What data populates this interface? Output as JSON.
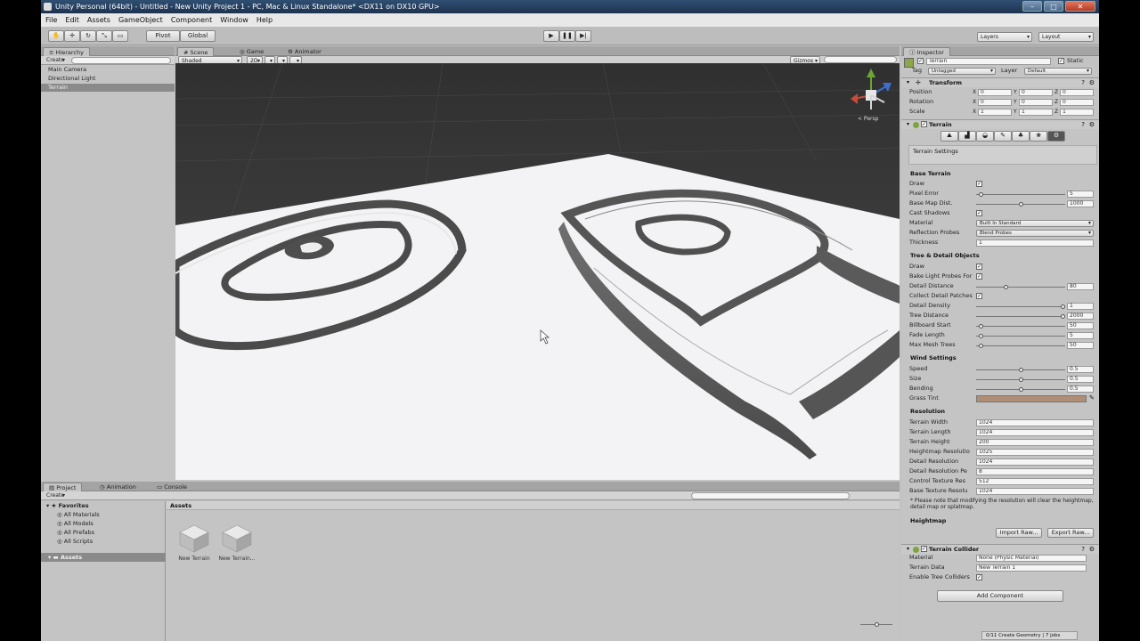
{
  "window": {
    "title": "Unity Personal (64bit) - Untitled - New Unity Project 1 - PC, Mac & Linux Standalone* <DX11 on DX10 GPU>"
  },
  "menu": [
    "File",
    "Edit",
    "Assets",
    "GameObject",
    "Component",
    "Window",
    "Help"
  ],
  "toolbar": {
    "pivot": "Pivot",
    "global": "Global",
    "layers": "Layers",
    "layout": "Layout"
  },
  "hierarchy": {
    "tab": "Hierarchy",
    "create": "Create",
    "items": [
      "Main Camera",
      "Directional Light",
      "Terrain"
    ],
    "selected": "Terrain"
  },
  "scene": {
    "tab_scene": "Scene",
    "tab_game": "Game",
    "tab_animator": "Animator",
    "shading": "Shaded",
    "mode_2d": "2D",
    "gizmos": "Gizmos",
    "persp": "< Persp"
  },
  "project": {
    "tabs": [
      "Project",
      "Animation",
      "Console"
    ],
    "create": "Create",
    "favorites_label": "Favorites",
    "favorites": [
      "All Materials",
      "All Models",
      "All Prefabs",
      "All Scripts"
    ],
    "assets_label": "Assets",
    "breadcrumb": "Assets",
    "assets": [
      "New Terrain",
      "New Terrain..."
    ]
  },
  "inspector": {
    "tab": "Inspector",
    "object_name": "Terrain",
    "static": "Static",
    "tag_label": "Tag",
    "tag_value": "Untagged",
    "layer_label": "Layer",
    "layer_value": "Default",
    "transform": {
      "title": "Transform",
      "rows": [
        {
          "label": "Position",
          "x": "0",
          "y": "0",
          "z": "0"
        },
        {
          "label": "Rotation",
          "x": "0",
          "y": "0",
          "z": "0"
        },
        {
          "label": "Scale",
          "x": "1",
          "y": "1",
          "z": "1"
        }
      ]
    },
    "terrain": {
      "title": "Terrain",
      "settings_box": "Terrain Settings",
      "base_title": "Base Terrain",
      "base": [
        {
          "label": "Draw",
          "type": "check"
        },
        {
          "label": "Pixel Error",
          "type": "slider",
          "value": "5",
          "fraction": 0.03
        },
        {
          "label": "Base Map Dist.",
          "type": "slider",
          "value": "1000",
          "fraction": 0.5
        },
        {
          "label": "Cast Shadows",
          "type": "check"
        },
        {
          "label": "Material",
          "type": "dropdown",
          "value": "Built In Standard"
        },
        {
          "label": "Reflection Probes",
          "type": "dropdown",
          "value": "Blend Probes"
        },
        {
          "label": "Thickness",
          "type": "field",
          "value": "1"
        }
      ],
      "tree_title": "Tree & Detail Objects",
      "tree": [
        {
          "label": "Draw",
          "type": "check"
        },
        {
          "label": "Bake Light Probes For",
          "type": "check"
        },
        {
          "label": "Detail Distance",
          "type": "slider",
          "value": "80",
          "fraction": 0.33
        },
        {
          "label": "Collect Detail Patches",
          "type": "check"
        },
        {
          "label": "Detail Density",
          "type": "slider",
          "value": "1",
          "fraction": 1.0
        },
        {
          "label": "Tree Distance",
          "type": "slider",
          "value": "2000",
          "fraction": 1.0
        },
        {
          "label": "Billboard Start",
          "type": "slider",
          "value": "50",
          "fraction": 0.03
        },
        {
          "label": "Fade Length",
          "type": "slider",
          "value": "5",
          "fraction": 0.03
        },
        {
          "label": "Max Mesh Trees",
          "type": "slider",
          "value": "50",
          "fraction": 0.03
        }
      ],
      "wind_title": "Wind Settings",
      "wind": [
        {
          "label": "Speed",
          "type": "slider",
          "value": "0.5",
          "fraction": 0.5
        },
        {
          "label": "Size",
          "type": "slider",
          "value": "0.5",
          "fraction": 0.5
        },
        {
          "label": "Bending",
          "type": "slider",
          "value": "0.5",
          "fraction": 0.5
        },
        {
          "label": "Grass Tint",
          "type": "color",
          "color": "#b08e76"
        }
      ],
      "res_title": "Resolution",
      "resolution": [
        {
          "label": "Terrain Width",
          "value": "1024"
        },
        {
          "label": "Terrain Length",
          "value": "1024"
        },
        {
          "label": "Terrain Height",
          "value": "200"
        },
        {
          "label": "Heightmap Resolutio",
          "value": "1025"
        },
        {
          "label": "Detail Resolution",
          "value": "1024"
        },
        {
          "label": "Detail Resolution Pe",
          "value": "8"
        },
        {
          "label": "Control Texture Res",
          "value": "512"
        },
        {
          "label": "Base Texture Resolu",
          "value": "1024"
        }
      ],
      "note": "* Please note that modifying the resolution will clear the heightmap, detail map or splatmap.",
      "heightmap_title": "Heightmap",
      "import_raw": "Import Raw...",
      "export_raw": "Export Raw..."
    },
    "collider": {
      "title": "Terrain Collider",
      "rows": [
        {
          "label": "Material",
          "value": "None (Physic Material)"
        },
        {
          "label": "Terrain Data",
          "value": "New Terrain 1"
        },
        {
          "label": "Enable Tree Colliders",
          "value": ""
        }
      ]
    },
    "add_component": "Add Component"
  },
  "status": {
    "text": "0/11 Create Geometry | 7 jobs"
  },
  "colors": {
    "sky": "#3b3b3b",
    "terrain": "#f4f4f6",
    "panel": "#c4c4c4",
    "selection": "#8a8a8a",
    "titlebar": "#24405f"
  }
}
